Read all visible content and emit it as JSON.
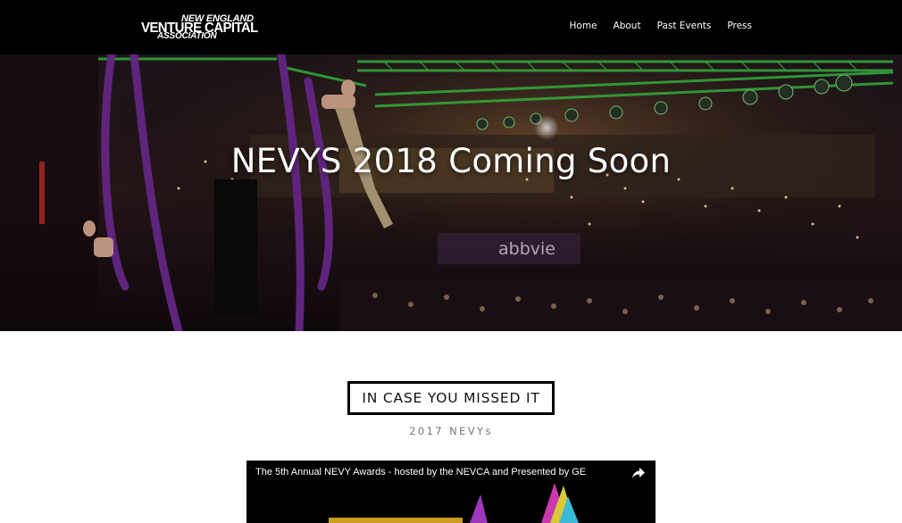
{
  "header": {
    "logo": {
      "line1": "NEW ENGLAND",
      "line2": "VENTURE CAPITAL",
      "line3": "ASSOCIATION"
    },
    "nav": [
      {
        "label": "Home"
      },
      {
        "label": "About"
      },
      {
        "label": "Past Events"
      },
      {
        "label": "Press"
      }
    ]
  },
  "hero": {
    "title": "NEVYS 2018 Coming Soon",
    "banner_text": "abbvie"
  },
  "section": {
    "heading": "IN CASE YOU MISSED IT",
    "subheading": "2017 NEVYs"
  },
  "video": {
    "title": "The 5th Annual NEVY Awards - hosted by the NEVCA and Presented by GE"
  },
  "colors": {
    "header_bg": "#000000",
    "truss_green": "#3fd14a",
    "silk_purple": "#7a2ea0"
  }
}
